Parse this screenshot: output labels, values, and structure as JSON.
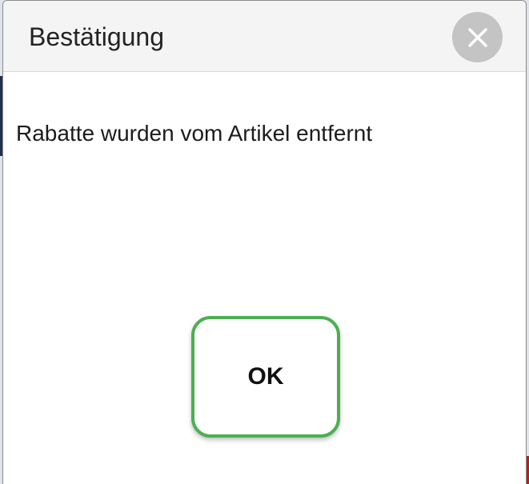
{
  "dialog": {
    "title": "Bestätigung",
    "message": "Rabatte wurden vom Artikel entfernt",
    "ok_label": "OK",
    "close_icon": "close-icon"
  },
  "colors": {
    "accent": "#4caf50",
    "close_bg": "#c4c4c4"
  }
}
